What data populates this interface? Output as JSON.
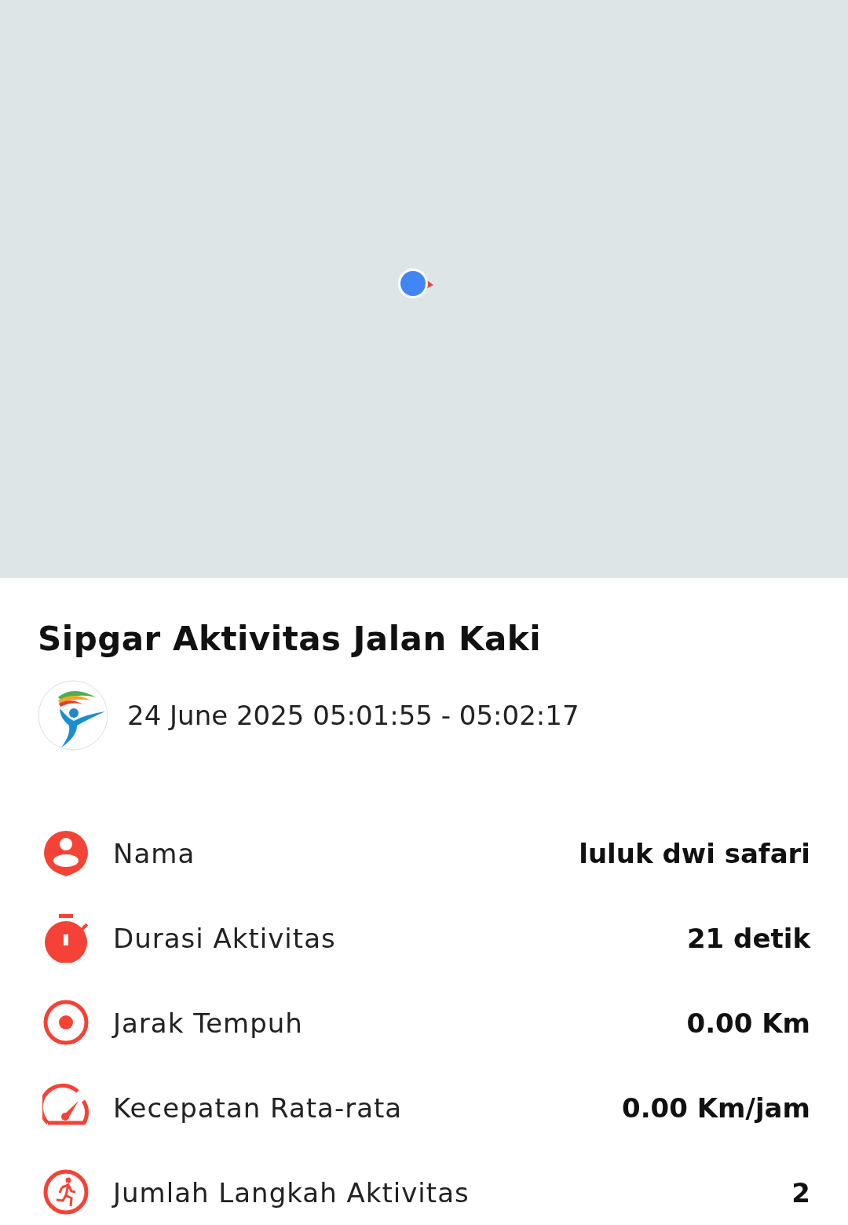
{
  "activity": {
    "title": "Sipgar Aktivitas Jalan Kaki",
    "time_range": "24 June 2025 05:01:55 - 05:02:17"
  },
  "stats": [
    {
      "kind": "person",
      "label": "Nama",
      "value": "luluk dwi safari"
    },
    {
      "kind": "timer",
      "label": "Durasi Aktivitas",
      "value": "21 detik"
    },
    {
      "kind": "distance",
      "label": "Jarak Tempuh",
      "value": "0.00 Km"
    },
    {
      "kind": "speed",
      "label": "Kecepatan Rata-rata",
      "value": "0.00 Km/jam"
    },
    {
      "kind": "steps",
      "label": "Jumlah Langkah Aktivitas",
      "value": "2"
    }
  ]
}
